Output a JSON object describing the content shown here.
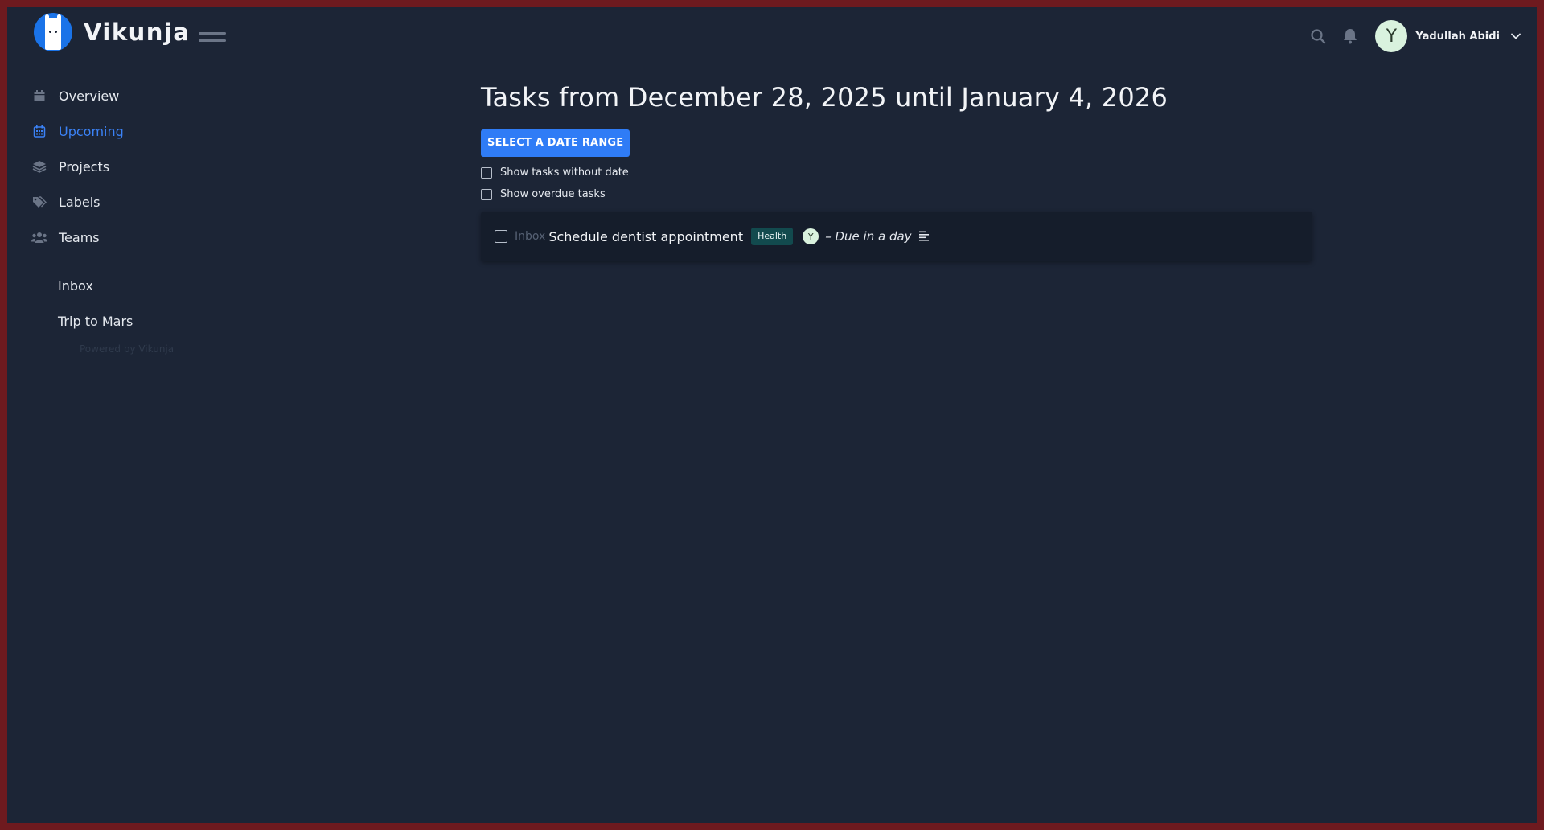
{
  "app": {
    "name": "Vikunja"
  },
  "header": {
    "user_initial": "Y",
    "user_name": "Yadullah Abidi"
  },
  "sidebar": {
    "items": [
      {
        "label": "Overview",
        "icon": "calendar-icon"
      },
      {
        "label": "Upcoming",
        "icon": "calendar-week-icon",
        "active": true
      },
      {
        "label": "Projects",
        "icon": "layers-icon"
      },
      {
        "label": "Labels",
        "icon": "tags-icon"
      },
      {
        "label": "Teams",
        "icon": "users-icon"
      }
    ],
    "projects": [
      {
        "label": "Inbox"
      },
      {
        "label": "Trip to Mars"
      }
    ],
    "powered_by": "Powered by Vikunja"
  },
  "main": {
    "title": "Tasks from December 28, 2025 until January 4, 2026",
    "date_range_button": "SELECT A DATE RANGE",
    "show_without_date_label": "Show tasks without date",
    "show_overdue_label": "Show overdue tasks",
    "tasks": [
      {
        "project": "Inbox",
        "title": "Schedule dentist appointment",
        "label": "Health",
        "assignee_initial": "Y",
        "due": "– Due in a day"
      }
    ]
  },
  "colors": {
    "background": "#1c2536",
    "accent": "#2f7cf6",
    "active_nav": "#3b82f6",
    "label_health": "#124a4e"
  }
}
